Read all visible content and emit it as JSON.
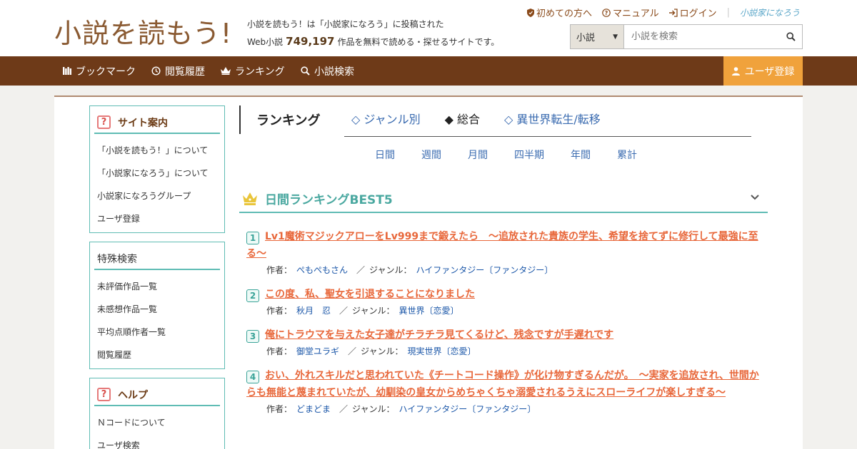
{
  "header": {
    "logo": "小説を読もう!",
    "tagline_line1": "小説を読もう！は「小説家になろう」に投稿された",
    "tagline_pre": "Web小説",
    "work_count": "749,197",
    "tagline_post": "作品を無料で読める・探せるサイトです。",
    "links": {
      "first_time": "初めての方へ",
      "manual": "マニュアル",
      "login": "ログイン",
      "narou": "小説家になろう"
    },
    "search": {
      "category": "小説",
      "placeholder": "小説を検索"
    }
  },
  "nav": {
    "bookmark": "ブックマーク",
    "history": "閲覧履歴",
    "ranking": "ランキング",
    "search": "小説検索",
    "register": "ユーザ登録"
  },
  "sidebar": {
    "site_guide": {
      "title": "サイト案内",
      "items": [
        "「小説を読もう！」について",
        "「小説家になろう」について",
        "小説家になろうグループ",
        "ユーザ登録"
      ]
    },
    "special_search": {
      "title": "特殊検索",
      "items": [
        "未評価作品一覧",
        "未感想作品一覧",
        "平均点順作者一覧",
        "閲覧履歴"
      ]
    },
    "help": {
      "title": "ヘルプ",
      "items": [
        "Ｎコードについて",
        "ユーザ検索"
      ]
    }
  },
  "ranking": {
    "heading": "ランキング",
    "tabs": [
      "◇ ジャンル別",
      "◆ 総合",
      "◇ 異世界転生/転移"
    ],
    "periods": [
      "日間",
      "週間",
      "月間",
      "四半期",
      "年間",
      "累計"
    ],
    "best_title": "日間ランキングBEST5",
    "labels": {
      "author": "作者：",
      "genre": "ジャンル：",
      "slash": "／"
    },
    "items": [
      {
        "rank": "1",
        "title": "Lv1魔術マジックアローをLv999まで鍛えたら　～追放された貴族の学生、希望を捨てずに修行して最強に至る～",
        "author": "ぺもぺもさん",
        "genre": "ハイファンタジー〔ファンタジー〕"
      },
      {
        "rank": "2",
        "title": "この度、私、聖女を引退することになりました",
        "author": "秋月　忍",
        "genre": "異世界〔恋愛〕"
      },
      {
        "rank": "3",
        "title": "俺にトラウマを与えた女子達がチラチラ見てくるけど、残念ですが手遅れです",
        "author": "御堂ユラギ",
        "genre": "現実世界〔恋愛〕"
      },
      {
        "rank": "4",
        "title": "おい、外れスキルだと思われていた《チートコード操作》が化け物すぎるんだが。　～実家を追放され、世間からも無能と蔑まれていたが、幼馴染の皇女からめちゃくちゃ溺愛されるうえにスローライフが楽しすぎる～",
        "author": "どまどま",
        "genre": "ハイファンタジー〔ファンタジー〕"
      }
    ]
  },
  "colors": {
    "brand_brown": "#6e3a18",
    "accent_orange": "#f0a23c",
    "teal": "#5fbcb4",
    "title_orange": "#e8673a",
    "link_blue": "#1a56a8"
  }
}
